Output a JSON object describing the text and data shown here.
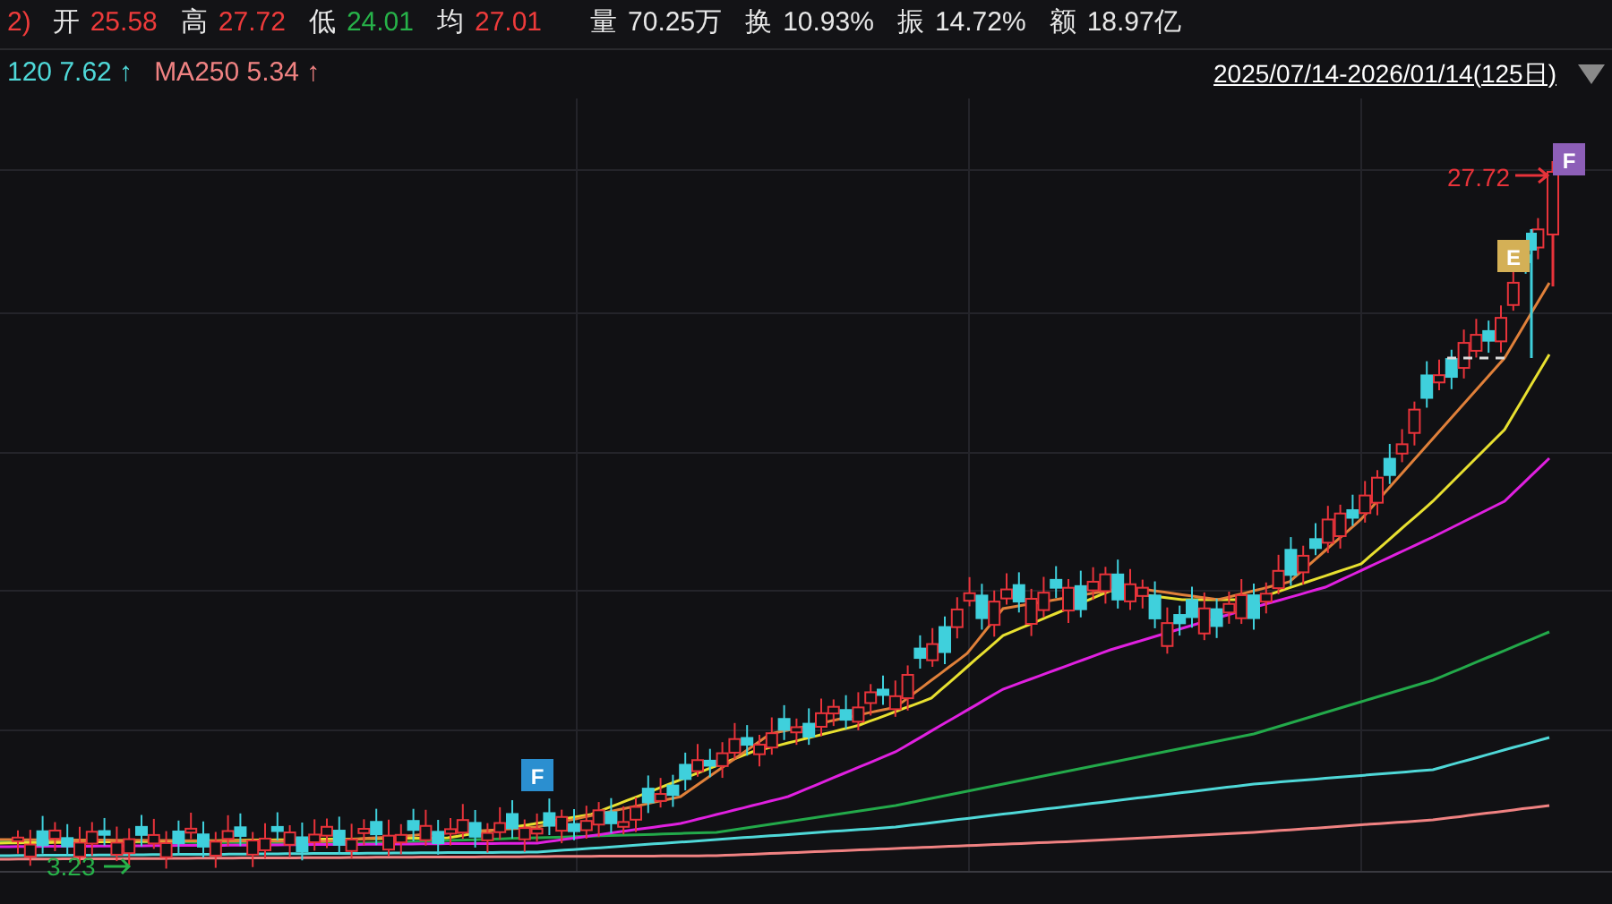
{
  "quote_bar": {
    "prefix": "2)",
    "fields": [
      {
        "label": "开",
        "value": "25.58",
        "color": "#ee3b3b"
      },
      {
        "label": "高",
        "value": "27.72",
        "color": "#ee3b3b"
      },
      {
        "label": "低",
        "value": "24.01",
        "color": "#27b249"
      },
      {
        "label": "均",
        "value": "27.01",
        "color": "#ee3b3b"
      },
      {
        "label": "量",
        "value": "70.25万",
        "color": "#e8e8e8"
      },
      {
        "label": "换",
        "value": "10.93%",
        "color": "#e8e8e8"
      },
      {
        "label": "振",
        "value": "14.72%",
        "color": "#e8e8e8"
      },
      {
        "label": "额",
        "value": "18.97亿",
        "color": "#e8e8e8"
      }
    ]
  },
  "ma_legend": [
    {
      "text": "120 7.62",
      "arrow": "↑",
      "color": "#4fd8d8"
    },
    {
      "text": "MA250 5.34",
      "arrow": "↑",
      "color": "#f08282"
    }
  ],
  "date_range": "2025/07/14-2026/01/14(125日)",
  "chart": {
    "high_label": "27.72",
    "low_label": "3.23",
    "markers": [
      {
        "letter": "F",
        "color": "#2b8fd0"
      },
      {
        "letter": "E",
        "color": "#d4b056"
      },
      {
        "letter": "F",
        "color": "#8d5fb8"
      }
    ]
  }
}
